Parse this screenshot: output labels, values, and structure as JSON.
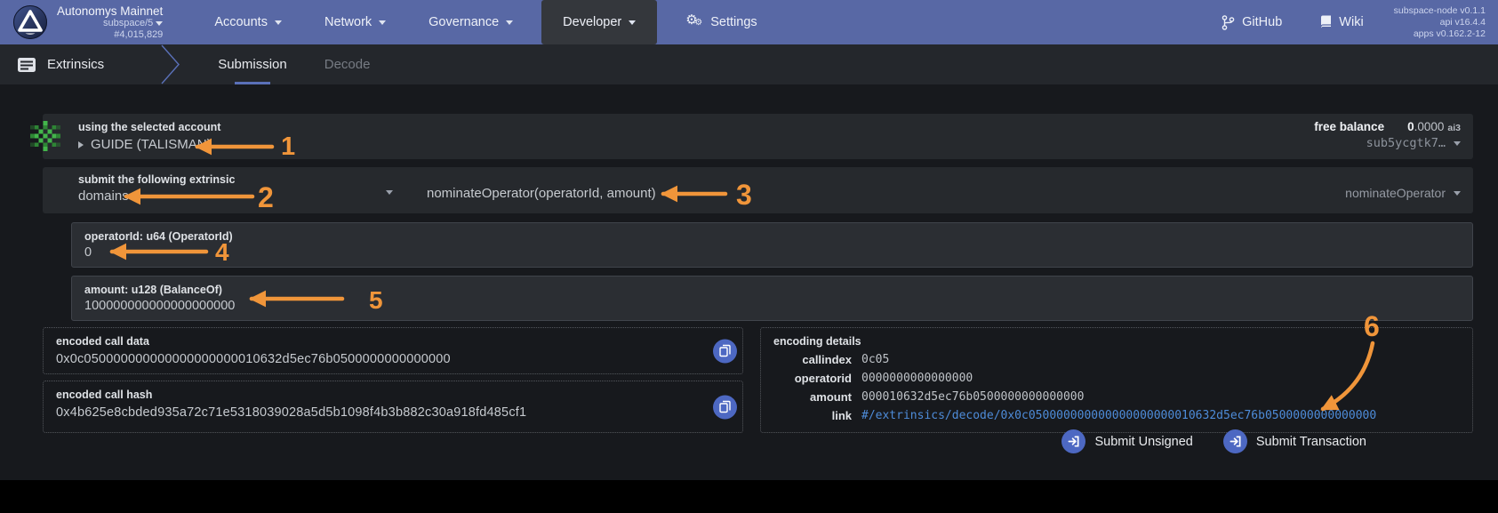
{
  "colors": {
    "navbar_blue": "#5868a5",
    "accent_blue": "#4d68c2",
    "orange": "#f0953a",
    "link_blue": "#4e8cd9"
  },
  "navbar": {
    "brand_title": "Autonomys Mainnet",
    "brand_network": "subspace/5",
    "brand_block": "#4,015,829",
    "items": [
      {
        "label": "Accounts"
      },
      {
        "label": "Network"
      },
      {
        "label": "Governance"
      },
      {
        "label": "Developer"
      },
      {
        "label": "Settings"
      }
    ],
    "github_label": "GitHub",
    "wiki_label": "Wiki",
    "versions": [
      "subspace-node v0.1.1",
      "api v16.4.4",
      "apps v0.162.2-12"
    ]
  },
  "tabbar": {
    "section": "Extrinsics",
    "tabs": [
      {
        "label": "Submission",
        "active": true
      },
      {
        "label": "Decode",
        "active": false
      }
    ]
  },
  "account": {
    "label": "using the selected account",
    "name": "GUIDE (TALISMAN)",
    "free_balance_label": "free balance",
    "balance_whole": "0",
    "balance_decimals": ".0000",
    "balance_unit": "ai3",
    "address": "sub5ycgtk7…"
  },
  "extrinsic": {
    "label": "submit the following extrinsic",
    "section": "domains",
    "method_signature": "nominateOperator(operatorId, amount)",
    "method_selected": "nominateOperator"
  },
  "params": [
    {
      "label": "operatorId: u64 (OperatorId)",
      "value": "0"
    },
    {
      "label": "amount: u128 (BalanceOf)",
      "value": "100000000000000000000"
    }
  ],
  "outputs": {
    "call_data_label": "encoded call data",
    "call_data": "0x0c050000000000000000000010632d5ec76b0500000000000000",
    "call_hash_label": "encoded call hash",
    "call_hash": "0x4b625e8cbded935a72c71e5318039028a5d5b1098f4b3b882c30a918fd485cf1",
    "details_label": "encoding details",
    "details": [
      {
        "label": "callindex",
        "value": "0c05"
      },
      {
        "label": "operatorid",
        "value": "0000000000000000"
      },
      {
        "label": "amount",
        "value": "000010632d5ec76b0500000000000000"
      },
      {
        "label": "link",
        "value": "#/extrinsics/decode/0x0c050000000000000000000010632d5ec76b0500000000000000"
      }
    ]
  },
  "actions": {
    "unsigned_label": "Submit Unsigned",
    "signed_label": "Submit Transaction"
  },
  "annotations": {
    "n1": "1",
    "n2": "2",
    "n3": "3",
    "n4": "4",
    "n5": "5",
    "n6": "6"
  }
}
